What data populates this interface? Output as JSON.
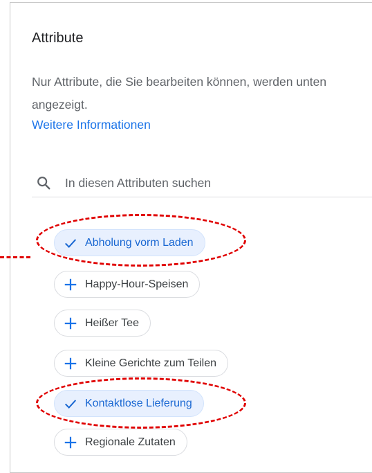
{
  "panel": {
    "title": "Attribute",
    "description": "Nur Attribute, die Sie bearbeiten können, werden unten angezeigt.",
    "learn_more": "Weitere Informationen"
  },
  "search": {
    "placeholder": "In diesen Attributen suchen",
    "icon": "search-icon"
  },
  "attributes": [
    {
      "label": "Abholung vorm Laden",
      "selected": true,
      "icon": "check-icon"
    },
    {
      "label": "Happy-Hour-Speisen",
      "selected": false,
      "icon": "plus-icon"
    },
    {
      "label": "Heißer Tee",
      "selected": false,
      "icon": "plus-icon"
    },
    {
      "label": "Kleine Gerichte zum Teilen",
      "selected": false,
      "icon": "plus-icon"
    },
    {
      "label": "Kontaktlose Lieferung",
      "selected": true,
      "icon": "check-icon"
    },
    {
      "label": "Regionale Zutaten",
      "selected": false,
      "icon": "plus-icon"
    }
  ],
  "colors": {
    "selected_chip_bg": "#e8f0fe",
    "selected_text": "#1967d2",
    "annotation": "#e00000",
    "link": "#1a73e8"
  }
}
